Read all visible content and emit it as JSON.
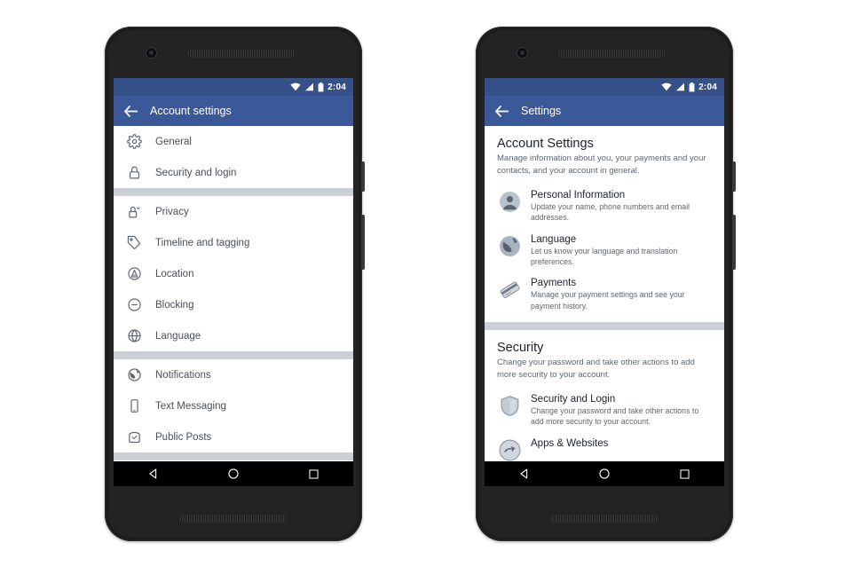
{
  "statusbar": {
    "time": "2:04",
    "wifi_icon": "wifi-icon",
    "signal_icon": "signal-icon",
    "battery_icon": "battery-icon"
  },
  "colors": {
    "appbar": "#3b5998",
    "statusbar": "#35508a",
    "divider": "#ccd0d5",
    "icon_gray": "#606770",
    "title": "#1d2129",
    "navbar": "#000000"
  },
  "left_phone": {
    "appbar": {
      "title": "Account settings",
      "back_icon": "back-arrow-icon"
    },
    "groups": [
      {
        "items": [
          {
            "label": "General",
            "icon": "gear-icon"
          },
          {
            "label": "Security and login",
            "icon": "lock-icon"
          }
        ]
      },
      {
        "items": [
          {
            "label": "Privacy",
            "icon": "lock-chevron-icon"
          },
          {
            "label": "Timeline and tagging",
            "icon": "tag-icon"
          },
          {
            "label": "Location",
            "icon": "location-triangle-icon"
          },
          {
            "label": "Blocking",
            "icon": "block-minus-icon"
          },
          {
            "label": "Language",
            "icon": "globe-icon"
          }
        ]
      },
      {
        "items": [
          {
            "label": "Notifications",
            "icon": "notifications-globe-icon"
          },
          {
            "label": "Text Messaging",
            "icon": "mobile-phone-icon"
          },
          {
            "label": "Public Posts",
            "icon": "public-posts-icon"
          }
        ]
      }
    ]
  },
  "right_phone": {
    "appbar": {
      "title": "Settings",
      "back_icon": "back-arrow-icon"
    },
    "sections": [
      {
        "title": "Account Settings",
        "description": "Manage information about you, your payments and your contacts, and your account in general.",
        "items": [
          {
            "title": "Personal Information",
            "description": "Update your name, phone numbers and email addresses.",
            "icon": "person-avatar-icon"
          },
          {
            "title": "Language",
            "description": "Let us know your language and translation preferences.",
            "icon": "globe-filled-icon"
          },
          {
            "title": "Payments",
            "description": "Manage your payment settings and see your payment history.",
            "icon": "credit-card-icon"
          }
        ]
      },
      {
        "title": "Security",
        "description": "Change your password and take other actions to add more security to your account.",
        "items": [
          {
            "title": "Security and Login",
            "description": "Change your password and take other actions to add more security to your account.",
            "icon": "shield-icon"
          },
          {
            "title": "Apps & Websites",
            "description": "",
            "icon": "apps-websites-icon"
          }
        ]
      }
    ]
  },
  "navbar": {
    "back_label": "back-nav-button",
    "home_label": "home-nav-button",
    "recents_label": "recents-nav-button"
  }
}
